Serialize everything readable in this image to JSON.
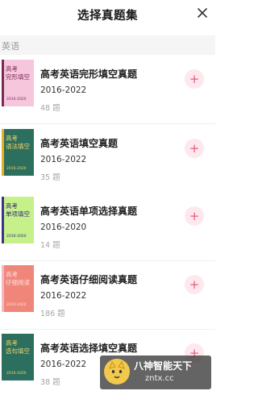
{
  "header": {
    "title": "选择真题集"
  },
  "section": {
    "label": "英语"
  },
  "items": [
    {
      "cover_text": "高考\n完形填空",
      "cover_year": "2016-2020",
      "cover_bg": "#f6c6dd",
      "cover_stripe": "#7b2a55",
      "cover_fg": "#7b2a55",
      "title": "高考英语完形填空真题",
      "range": "2016-2022",
      "count": "48 题"
    },
    {
      "cover_text": "高考\n语法填空",
      "cover_year": "2016-2020",
      "cover_bg": "#2c6f5e",
      "cover_stripe": "#e3b12a",
      "cover_fg": "#f3d46a",
      "title": "高考英语填空真题",
      "range": "2016-2022",
      "count": "35 题"
    },
    {
      "cover_text": "高考\n单项填空",
      "cover_year": "2016-2020",
      "cover_bg": "#c6f08a",
      "cover_stripe": "#3d3488",
      "cover_fg": "#2e2a70",
      "title": "高考英语单项选择真题",
      "range": "2016-2020",
      "count": "14 题"
    },
    {
      "cover_text": "高考\n仔细阅读",
      "cover_year": "2016-2020",
      "cover_bg": "#f0857a",
      "cover_stripe": "#f6b8c4",
      "cover_fg": "#fde2dd",
      "title": "高考英语仔细阅读真题",
      "range": "2016-2022",
      "count": "186 题"
    },
    {
      "cover_text": "高考\n选句填空",
      "cover_year": "2016-2020",
      "cover_bg": "#2c6f5e",
      "cover_stripe": "#2c6f5e",
      "cover_fg": "#f3d46a",
      "title": "高考英语选择填空真题",
      "range": "2016-2022",
      "count": "38 题"
    }
  ],
  "add_button": {
    "label": "+"
  },
  "watermark": {
    "line1": "八神智能天下",
    "line2": "zntx.cc"
  }
}
